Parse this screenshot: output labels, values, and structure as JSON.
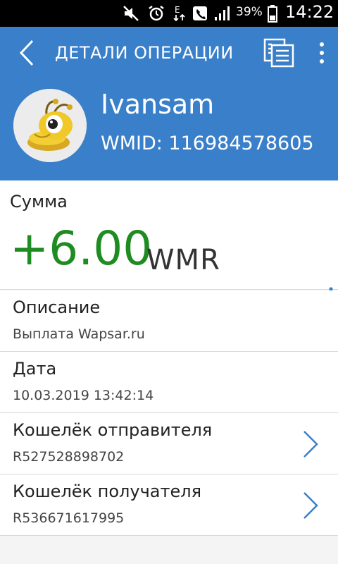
{
  "status_bar": {
    "battery_percent": "39%",
    "time": "14:22",
    "icons": [
      "mute-icon",
      "alarm-icon",
      "data-e-icon",
      "phone-icon",
      "signal-icon",
      "battery-icon"
    ]
  },
  "header": {
    "title": "ДЕТАЛИ ОПЕРАЦИИ",
    "account_name": "Ivansam",
    "wmid": "WMID: 116984578605"
  },
  "amount": {
    "label": "Сумма",
    "value": "+6.00",
    "currency": "WMR"
  },
  "details": [
    {
      "title": "Описание",
      "value": "Выплата Wapsar.ru"
    },
    {
      "title": "Дата",
      "value": "10.03.2019 13:42:14"
    },
    {
      "title": "Кошелёк отправителя",
      "value": "R527528898702"
    },
    {
      "title": "Кошелёк получателя",
      "value": "R536671617995"
    }
  ],
  "colors": {
    "header_bg": "#3a7fc9",
    "amount_green": "#1f8c22",
    "chevron_blue": "#3a7fc9"
  }
}
